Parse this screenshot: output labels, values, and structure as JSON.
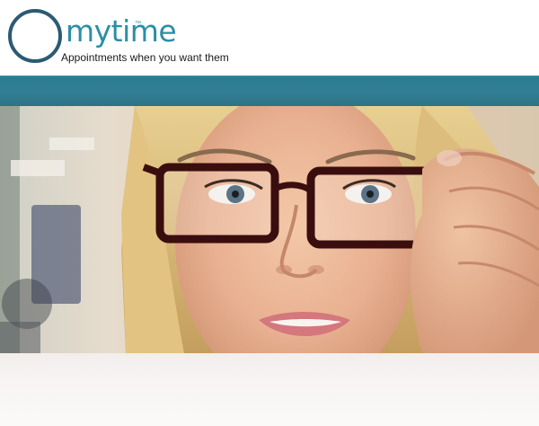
{
  "brand": {
    "wordmark": "mytime",
    "trademark": "™",
    "tagline": "Appointments when you want them",
    "accent_color": "#2a8fa6",
    "ring_color": "#2c5a73"
  },
  "nav": {
    "bar_color": "#327f95"
  },
  "hero": {
    "subject": "woman-with-glasses-photo"
  }
}
